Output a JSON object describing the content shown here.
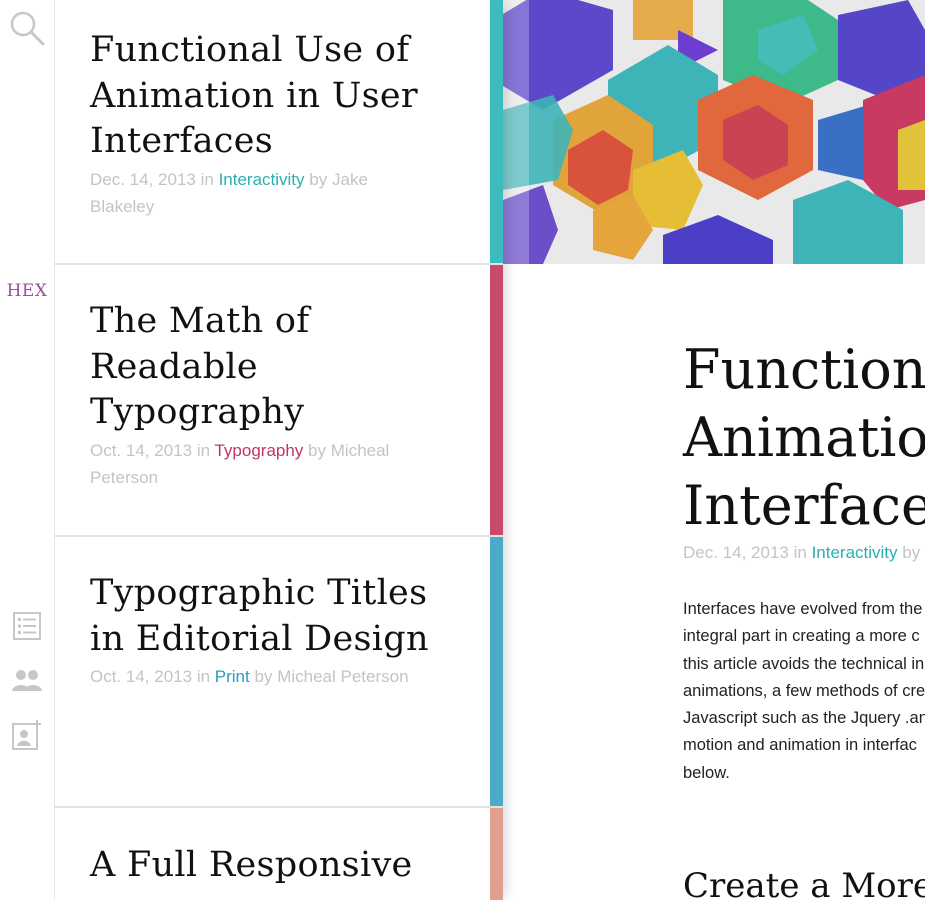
{
  "sidebar": {
    "brand": "HEX",
    "icons": [
      "search-icon",
      "list-icon",
      "people-icon",
      "add-contact-icon"
    ]
  },
  "posts": [
    {
      "title_lines": [
        "Functional Use of",
        "Animation in User",
        "Interfaces"
      ],
      "date": "Dec. 14, 2013",
      "in": "in",
      "category": "Interactivity",
      "by": "by",
      "author": "Jake Blakeley",
      "accent": "#3cbcbc"
    },
    {
      "title_lines": [
        "The Math of",
        "Readable",
        "Typography"
      ],
      "date": "Oct. 14, 2013",
      "in": "in",
      "category": "Typography",
      "by": "by",
      "author": "Micheal Peterson",
      "accent": "#c84a68"
    },
    {
      "title_lines": [
        "Typographic Titles",
        "in Editorial Design"
      ],
      "date": "Oct. 14, 2013",
      "in": "in",
      "category": "Print",
      "by": "by",
      "author": "Micheal Peterson",
      "accent": "#4aaac8"
    },
    {
      "title_lines": [
        "A Full Responsive"
      ],
      "accent": "#e0a090"
    }
  ],
  "article": {
    "title_lines": [
      "Function",
      "Animatio",
      "Interface"
    ],
    "date": "Dec. 14, 2013",
    "in": "in",
    "category": "Interactivity",
    "by": "by J",
    "body_lines": [
      "Interfaces have evolved from the",
      "integral part in creating a more c",
      "this article avoids the technical in",
      "animations, a few methods of cre",
      "Javascript such as the Jquery .an",
      "motion and animation in interfac",
      "below."
    ],
    "subhead": "Create a More"
  },
  "colors": {
    "interactivity": "#2ab0b0",
    "typography": "#c2365f",
    "print": "#2a9cc0",
    "brand": "#9b4ea3"
  }
}
